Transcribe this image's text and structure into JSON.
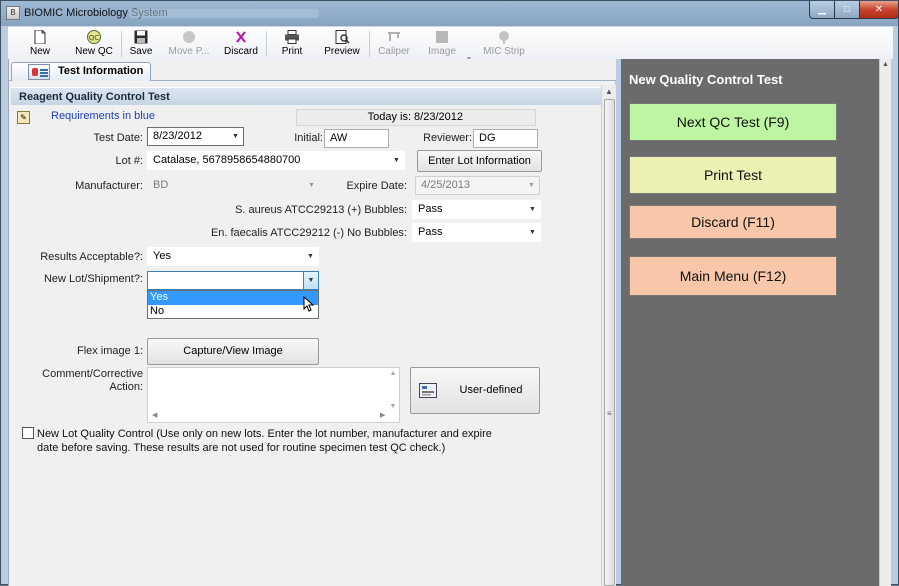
{
  "window": {
    "title": "BIOMIC Microbiology System",
    "min_glyph": "▁",
    "max_glyph": "□",
    "close_glyph": "✕"
  },
  "toolbar": {
    "new": "New",
    "new_qc": "New QC",
    "save": "Save",
    "move": "Move P...",
    "discard": "Discard",
    "print": "Print",
    "preview": "Preview",
    "caliper": "Caliper",
    "image": "Image",
    "mic_strip": "MIC Strip"
  },
  "tab": {
    "label": "Test Information"
  },
  "section": {
    "title": "Reagent Quality Control Test"
  },
  "form": {
    "requirements_note": "Requirements in blue",
    "today": "Today is: 8/23/2012",
    "test_date_label": "Test Date:",
    "test_date": "8/23/2012",
    "initial_label": "Initial:",
    "initial": "AW",
    "reviewer_label": "Reviewer:",
    "reviewer": "DG",
    "lot_label": "Lot #:",
    "lot": "Catalase, 5678958654880700",
    "enter_lot_button": "Enter Lot Information",
    "manufacturer_label": "Manufacturer:",
    "manufacturer": "BD",
    "expire_label": "Expire Date:",
    "expire": "4/25/2013",
    "s_aureus_label": "S. aureus ATCC29213  (+) Bubbles:",
    "s_aureus": "Pass",
    "en_faecalis_label": "En. faecalis ATCC29212  (-) No Bubbles:",
    "en_faecalis": "Pass",
    "results_label": "Results Acceptable?:",
    "results": "Yes",
    "new_lot_label": "New Lot/Shipment?:",
    "new_lot": "",
    "new_lot_options": [
      "Yes",
      "No"
    ],
    "flex_label": "Flex image 1:",
    "capture_button": "Capture/View Image",
    "comment_label_1": "Comment/Corrective",
    "comment_label_2": "Action:",
    "user_defined_button": "User-defined",
    "new_lot_qc_text": "New Lot Quality Control (Use only on new lots. Enter the lot number, manufacturer and expire date before saving. These results are not used for routine specimen test QC check.)"
  },
  "right_panel": {
    "title": "New Quality Control Test",
    "next_button": "Next QC Test (F9)",
    "print_button": "Print Test",
    "discard_button": "Discard (F11)",
    "main_menu_button": "Main Menu (F12)"
  },
  "colors": {
    "next": "#bdf5a3",
    "print": "#ecf0b2",
    "discard": "#f8c7a9",
    "main_menu": "#f8c7a9",
    "panel": "#6b6b6b",
    "requirements": "#1c3fbf"
  }
}
